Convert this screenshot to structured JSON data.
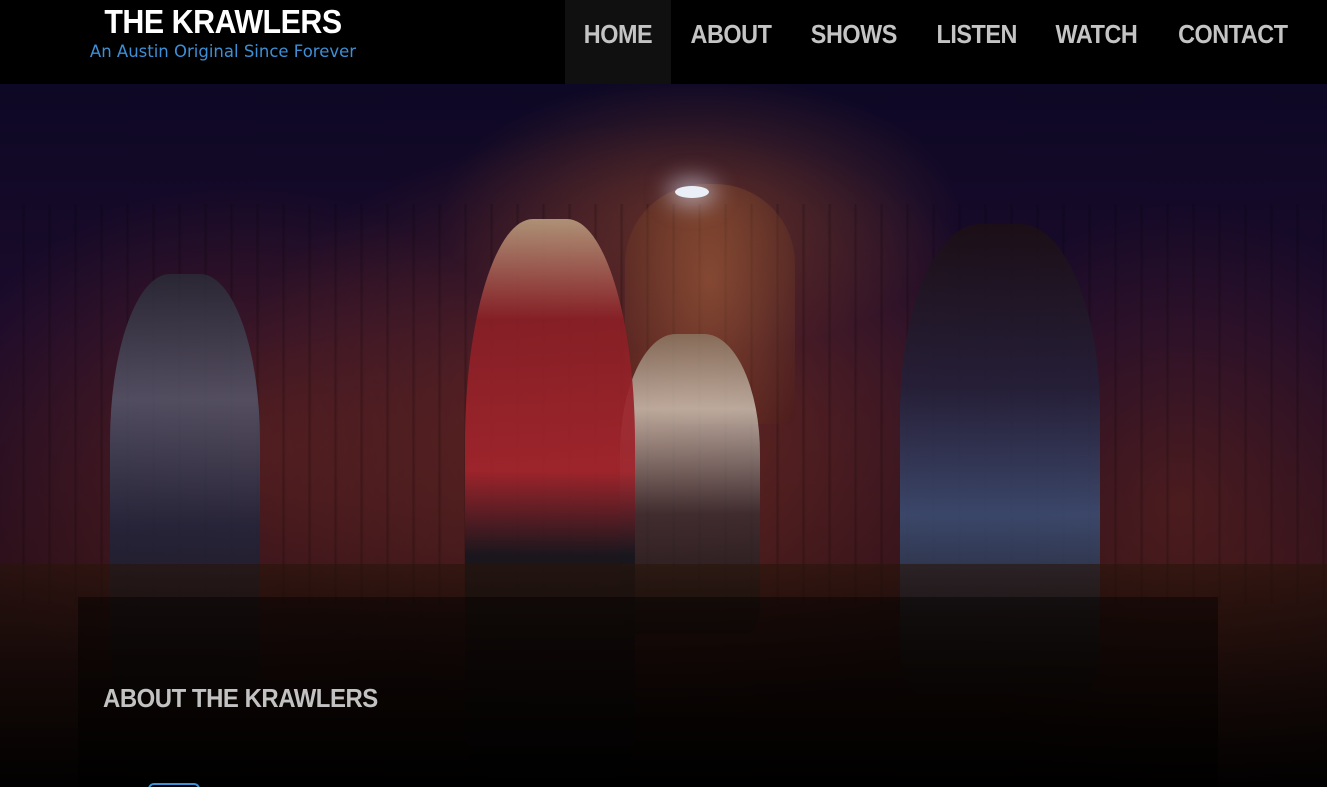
{
  "site": {
    "title": "THE KRAWLERS",
    "tagline": "An Austin Original Since Forever"
  },
  "nav": {
    "items": [
      {
        "label": "HOME",
        "active": true
      },
      {
        "label": "ABOUT",
        "active": false
      },
      {
        "label": "SHOWS",
        "active": false
      },
      {
        "label": "LISTEN",
        "active": false
      },
      {
        "label": "WATCH",
        "active": false
      },
      {
        "label": "CONTACT",
        "active": false
      }
    ]
  },
  "about": {
    "heading": "ABOUT THE KRAWLERS"
  },
  "colors": {
    "header_bg": "#000000",
    "accent": "#3d8fd6",
    "nav_text": "#c4c4c4",
    "title_text": "#ffffff"
  }
}
